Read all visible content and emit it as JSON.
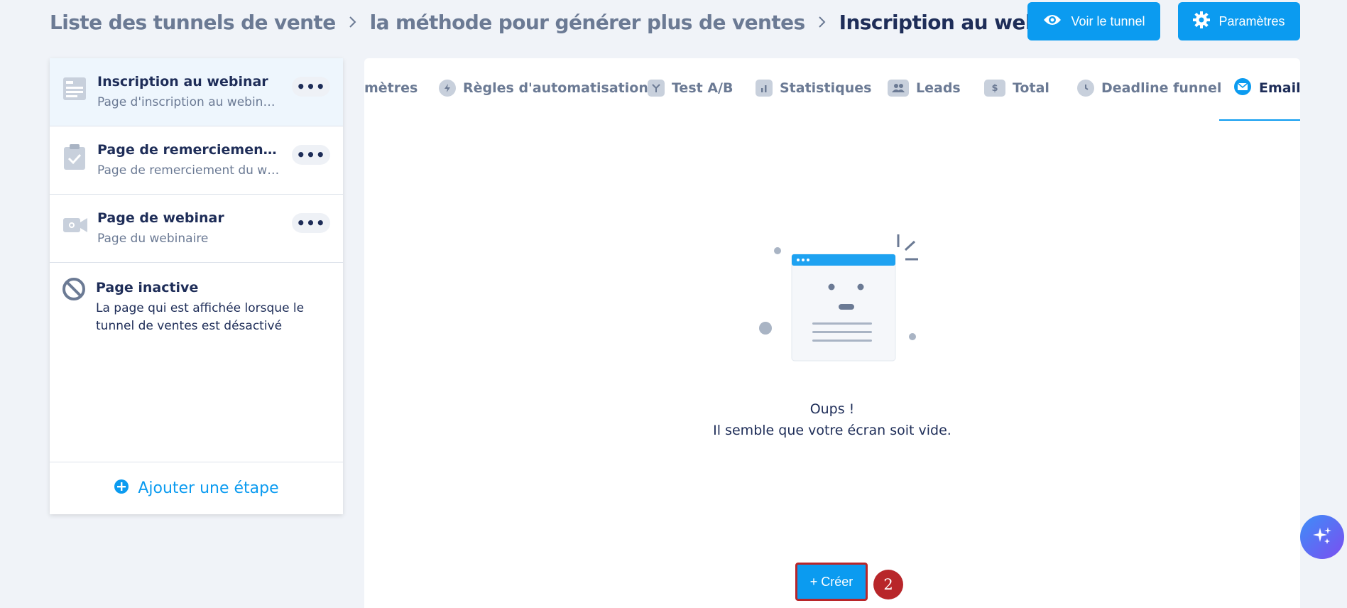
{
  "breadcrumb": {
    "items": [
      "Liste des tunnels de vente",
      "la méthode pour générer plus de ventes",
      "Inscription au webinar"
    ]
  },
  "header": {
    "view_button": "Voir le tunnel",
    "settings_button": "Paramètres"
  },
  "sidebar": {
    "steps": [
      {
        "title": "Inscription au webinar",
        "subtitle": "Page d'inscription au webinaire",
        "more": "•••"
      },
      {
        "title": "Page de remerciement (Webinaire)",
        "subtitle": "Page de remerciement du webinaire",
        "more": "•••"
      },
      {
        "title": "Page de webinar",
        "subtitle": "Page du webinaire",
        "more": "•••"
      }
    ],
    "inactive": {
      "title": "Page inactive",
      "description": "La page qui est affichée lorsque le tunnel de ventes est désactivé"
    },
    "add_step": "Ajouter une étape"
  },
  "tabs": [
    {
      "label": "mètres",
      "icon": "settings-icon"
    },
    {
      "label": "Règles d'automatisation",
      "icon": "bolt-icon"
    },
    {
      "label": "Test A/B",
      "icon": "split-icon"
    },
    {
      "label": "Statistiques",
      "icon": "bar-chart-icon"
    },
    {
      "label": "Leads",
      "icon": "users-icon"
    },
    {
      "label": "Total",
      "icon": "dollar-icon"
    },
    {
      "label": "Deadline funnel",
      "icon": "clock-icon"
    },
    {
      "label": "Emails",
      "icon": "mail-icon"
    }
  ],
  "active_tab": "Emails",
  "empty_state": {
    "title": "Oups !",
    "subtitle": "Il semble que votre écran soit vide."
  },
  "create_button": "+ Créer",
  "annotation_step": "2",
  "colors": {
    "accent": "#0b9bf0",
    "highlight": "#b8262a",
    "text_dark": "#1e2d58",
    "text_muted": "#6b7a94"
  }
}
